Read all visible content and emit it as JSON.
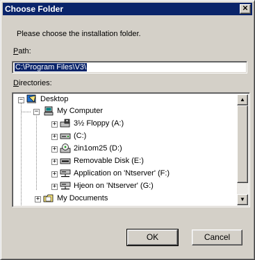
{
  "window": {
    "title": "Choose Folder",
    "close_glyph": "✕"
  },
  "prompt": "Please choose the installation folder.",
  "path": {
    "label_accel": "P",
    "label_rest": "ath:",
    "value": "C:\\Program Files\\V3\\"
  },
  "directories": {
    "label_accel": "D",
    "label_rest": "irectories:"
  },
  "tree": {
    "items": [
      {
        "label": "Desktop",
        "icon": "desktop-icon",
        "expander": "−"
      },
      {
        "label": "My Computer",
        "icon": "computer-icon",
        "expander": "−"
      },
      {
        "label": "3½ Floppy (A:)",
        "icon": "floppy-drive-icon",
        "expander": "+"
      },
      {
        "label": " (C:)",
        "icon": "hard-drive-icon",
        "expander": "+"
      },
      {
        "label": "2in1om25 (D:)",
        "icon": "cd-drive-icon",
        "expander": "+"
      },
      {
        "label": "Removable Disk (E:)",
        "icon": "removable-drive-icon",
        "expander": "+"
      },
      {
        "label": "Application on 'Ntserver' (F:)",
        "icon": "network-drive-icon",
        "expander": "+"
      },
      {
        "label": "Hjeon on 'Ntserver' (G:)",
        "icon": "network-drive-icon",
        "expander": "+"
      },
      {
        "label": "My Documents",
        "icon": "folder-icon",
        "expander": "+"
      }
    ]
  },
  "scrollbar": {
    "up_glyph": "▲",
    "down_glyph": "▼"
  },
  "buttons": {
    "ok": "OK",
    "cancel": "Cancel"
  }
}
